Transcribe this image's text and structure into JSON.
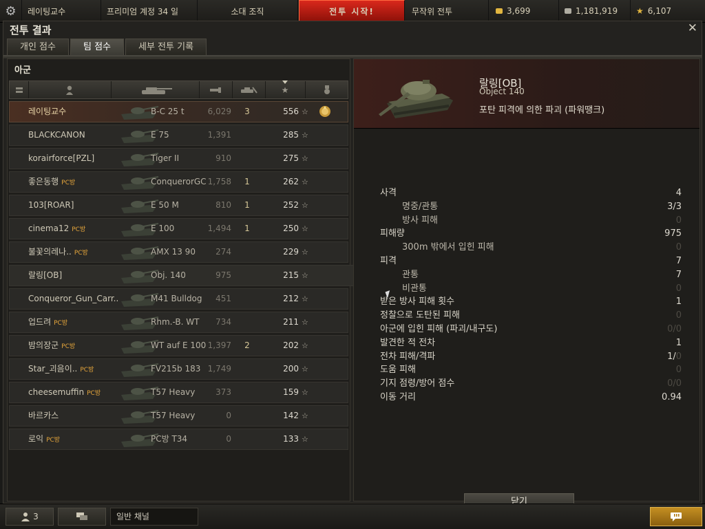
{
  "topbar": {
    "player": "레이팅교수",
    "premium": "프리미엄 계정 34 일",
    "squad": "소대 조직",
    "battle": "전투 시작!",
    "mode": "무작위 전투",
    "gold": "3,699",
    "credits": "1,181,919",
    "free_xp": "6,107"
  },
  "dialog": {
    "title": "전투 결과",
    "tabs": [
      {
        "label": "개인 점수"
      },
      {
        "label": "팀 점수"
      },
      {
        "label": "세부 전투 기록"
      }
    ]
  },
  "team": {
    "label": "아군",
    "rows": [
      {
        "name": "레이팅교수",
        "pc": "",
        "tank": "B-C 25 t",
        "xp": "6,029",
        "kills": "3",
        "score": "556",
        "star": "☆"
      },
      {
        "name": "BLACKCANON",
        "pc": "",
        "tank": "E 75",
        "xp": "1,391",
        "kills": "",
        "score": "285",
        "star": "☆"
      },
      {
        "name": "korairforce[PZL]",
        "pc": "",
        "tank": "Tiger II",
        "xp": "910",
        "kills": "",
        "score": "275",
        "star": "☆"
      },
      {
        "name": "좋은동행",
        "pc": "PC방",
        "tank": "ConquerorGC",
        "xp": "1,758",
        "kills": "1",
        "score": "262",
        "star": "☆"
      },
      {
        "name": "103[ROAR]",
        "pc": "",
        "tank": "E 50 M",
        "xp": "810",
        "kills": "1",
        "score": "252",
        "star": "☆"
      },
      {
        "name": "cinema12",
        "pc": "PC방",
        "tank": "E 100",
        "xp": "1,494",
        "kills": "1",
        "score": "250",
        "star": "☆"
      },
      {
        "name": "불꽃의레나..",
        "pc": "PC방",
        "tank": "AMX 13 90",
        "xp": "274",
        "kills": "",
        "score": "229",
        "star": "☆"
      },
      {
        "name": "랄링[OB]",
        "pc": "",
        "tank": "Obj. 140",
        "xp": "975",
        "kills": "",
        "score": "215",
        "star": "☆"
      },
      {
        "name": "Conqueror_Gun_Carr..",
        "pc": "",
        "tank": "M41 Bulldog",
        "xp": "451",
        "kills": "",
        "score": "212",
        "star": "☆"
      },
      {
        "name": "업드려",
        "pc": "PC방",
        "tank": "Rhm.-B. WT",
        "xp": "734",
        "kills": "",
        "score": "211",
        "star": "☆"
      },
      {
        "name": "밤의장군",
        "pc": "PC방",
        "tank": "WT auf E 100",
        "xp": "1,397",
        "kills": "2",
        "score": "202",
        "star": "☆"
      },
      {
        "name": "Star_괴음이..",
        "pc": "PC방",
        "tank": "FV215b 183",
        "xp": "1,749",
        "kills": "",
        "score": "200",
        "star": "☆"
      },
      {
        "name": "cheesemuffin",
        "pc": "PC방",
        "tank": "T57 Heavy",
        "xp": "373",
        "kills": "",
        "score": "159",
        "star": "☆"
      },
      {
        "name": "바르카스",
        "pc": "",
        "tank": "T57 Heavy",
        "xp": "0",
        "kills": "",
        "score": "142",
        "star": "☆"
      },
      {
        "name": "로익",
        "pc": "PC방",
        "tank": "PC방 T34",
        "xp": "0",
        "kills": "",
        "score": "133",
        "star": "☆"
      }
    ]
  },
  "detail": {
    "player": "랄링[OB]",
    "tank": "Object 140",
    "fate": "포탄 피격에 의한 파괴 (파워땡크)",
    "stats": [
      {
        "label": "사격",
        "value": "4",
        "sub": false,
        "dim": false
      },
      {
        "label": "명중/관통",
        "value": "3/3",
        "sub": true,
        "dim": false
      },
      {
        "label": "방사 피해",
        "value": "0",
        "sub": true,
        "dim": true
      },
      {
        "label": "피해량",
        "value": "975",
        "sub": false,
        "dim": false
      },
      {
        "label": "300m 밖에서 입힌 피해",
        "value": "0",
        "sub": true,
        "dim": true
      },
      {
        "label": "피격",
        "value": "7",
        "sub": false,
        "dim": false
      },
      {
        "label": "관통",
        "value": "7",
        "sub": true,
        "dim": false
      },
      {
        "label": "비관통",
        "value": "0",
        "sub": true,
        "dim": true
      },
      {
        "label": "받은 방사 피해 횟수",
        "value": "1",
        "sub": false,
        "dim": false
      },
      {
        "label": "정찰으로 도탄된 피해",
        "value": "0",
        "sub": false,
        "dim": true
      },
      {
        "label": "아군에 입힌 피해 (파괴/내구도)",
        "value": "0/0",
        "sub": false,
        "dim": true
      },
      {
        "label": "발견한 적 전차",
        "value": "1",
        "sub": false,
        "dim": false
      },
      {
        "label": "전차 피해/격파",
        "value": "1/0",
        "sub": false,
        "dim": false,
        "split": true
      },
      {
        "label": "도움 피해",
        "value": "0",
        "sub": false,
        "dim": true
      },
      {
        "label": "기지 점령/방어 점수",
        "value": "0/0",
        "sub": false,
        "dim": true
      },
      {
        "label": "이동 거리",
        "value": "0.94",
        "sub": false,
        "dim": false
      }
    ],
    "close_label": "닫기"
  },
  "bottom": {
    "squad_count": "3",
    "channel": "일반 채널"
  },
  "colors": {
    "battle_button": "#c8241a",
    "self_row": "#4a2f22",
    "message_button": "#c48f22"
  },
  "icons": [
    "gear-icon",
    "close-icon",
    "player-icon",
    "tank-icon",
    "damage-icon",
    "kills-icon",
    "star-icon",
    "medal-icon",
    "people-icon",
    "chat-icon",
    "message-icon"
  ]
}
